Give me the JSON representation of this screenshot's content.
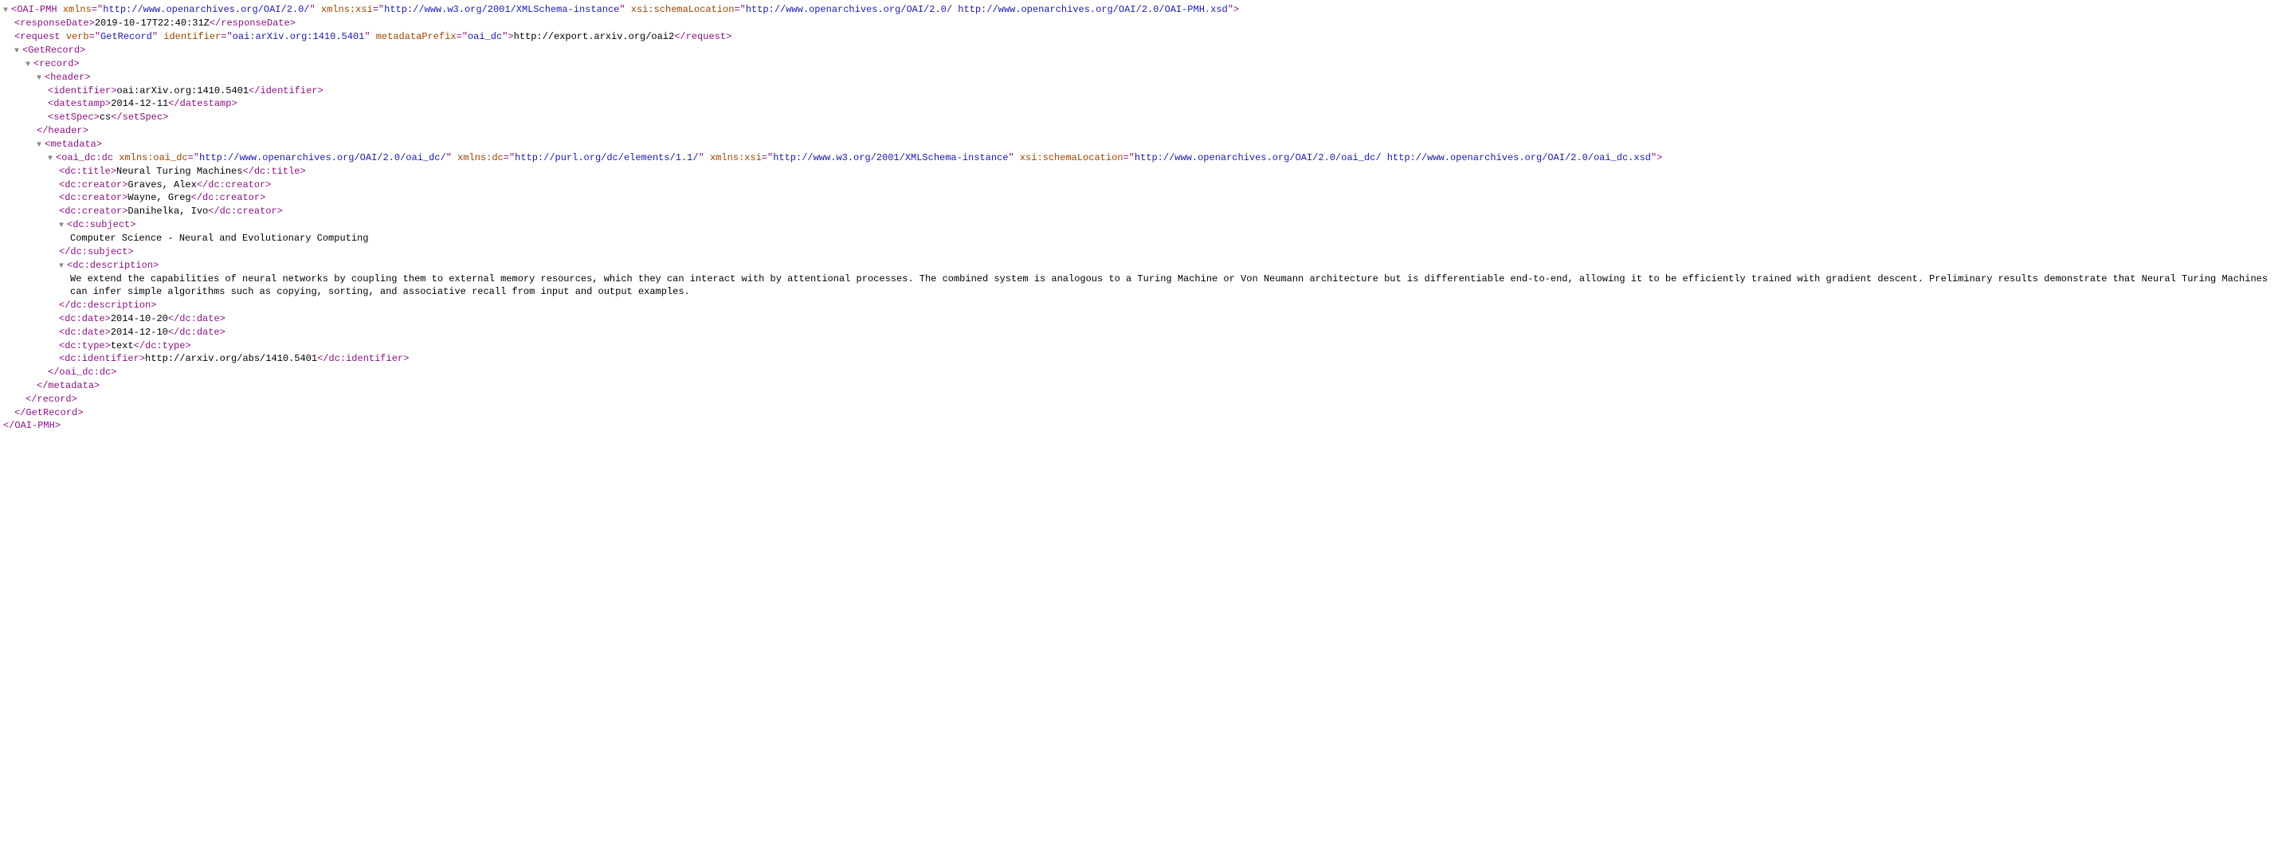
{
  "root": {
    "tag": "OAI-PMH",
    "attrs": [
      {
        "name": "xmlns",
        "value": "http://www.openarchives.org/OAI/2.0/"
      },
      {
        "name": "xmlns:xsi",
        "value": "http://www.w3.org/2001/XMLSchema-instance"
      },
      {
        "name": "xsi:schemaLocation",
        "value": "http://www.openarchives.org/OAI/2.0/ http://www.openarchives.org/OAI/2.0/OAI-PMH.xsd"
      }
    ]
  },
  "responseDate": {
    "tag": "responseDate",
    "text": "2019-10-17T22:40:31Z"
  },
  "request": {
    "tag": "request",
    "attrs": [
      {
        "name": "verb",
        "value": "GetRecord"
      },
      {
        "name": "identifier",
        "value": "oai:arXiv.org:1410.5401"
      },
      {
        "name": "metadataPrefix",
        "value": "oai_dc"
      }
    ],
    "text": "http://export.arxiv.org/oai2"
  },
  "getRecord": {
    "tag": "GetRecord"
  },
  "record": {
    "tag": "record"
  },
  "header": {
    "tag": "header",
    "identifier": {
      "tag": "identifier",
      "text": "oai:arXiv.org:1410.5401"
    },
    "datestamp": {
      "tag": "datestamp",
      "text": "2014-12-11"
    },
    "setSpec": {
      "tag": "setSpec",
      "text": "cs"
    }
  },
  "metadata": {
    "tag": "metadata"
  },
  "oai_dc": {
    "tag": "oai_dc:dc",
    "attrs": [
      {
        "name": "xmlns:oai_dc",
        "value": "http://www.openarchives.org/OAI/2.0/oai_dc/"
      },
      {
        "name": "xmlns:dc",
        "value": "http://purl.org/dc/elements/1.1/"
      },
      {
        "name": "xmlns:xsi",
        "value": "http://www.w3.org/2001/XMLSchema-instance"
      },
      {
        "name": "xsi:schemaLocation",
        "value": "http://www.openarchives.org/OAI/2.0/oai_dc/ http://www.openarchives.org/OAI/2.0/oai_dc.xsd"
      }
    ]
  },
  "dc": {
    "title": {
      "tag": "dc:title",
      "text": "Neural Turing Machines"
    },
    "creator1": {
      "tag": "dc:creator",
      "text": "Graves, Alex"
    },
    "creator2": {
      "tag": "dc:creator",
      "text": "Wayne, Greg"
    },
    "creator3": {
      "tag": "dc:creator",
      "text": "Danihelka, Ivo"
    },
    "subject": {
      "tag": "dc:subject",
      "text": "Computer Science - Neural and Evolutionary Computing"
    },
    "description": {
      "tag": "dc:description",
      "text": "We extend the capabilities of neural networks by coupling them to external memory resources, which they can interact with by attentional processes. The combined system is analogous to a Turing Machine or Von Neumann architecture but is differentiable end-to-end, allowing it to be efficiently trained with gradient descent. Preliminary results demonstrate that Neural Turing Machines can infer simple algorithms such as copying, sorting, and associative recall from input and output examples."
    },
    "date1": {
      "tag": "dc:date",
      "text": "2014-10-20"
    },
    "date2": {
      "tag": "dc:date",
      "text": "2014-12-10"
    },
    "type": {
      "tag": "dc:type",
      "text": "text"
    },
    "identifier": {
      "tag": "dc:identifier",
      "text": "http://arxiv.org/abs/1410.5401"
    }
  }
}
